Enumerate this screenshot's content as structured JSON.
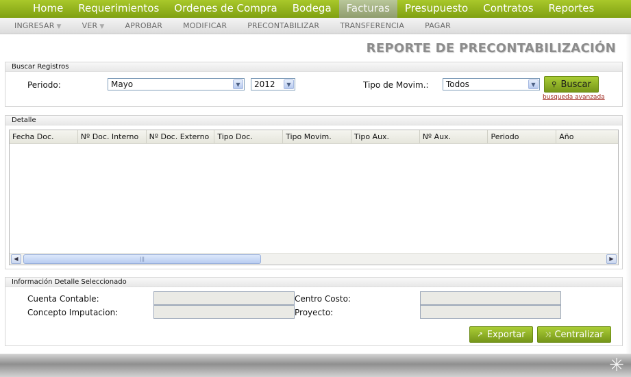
{
  "nav": {
    "items": [
      {
        "label": "Home",
        "active": false
      },
      {
        "label": "Requerimientos",
        "active": false
      },
      {
        "label": "Ordenes de Compra",
        "active": false
      },
      {
        "label": "Bodega",
        "active": false
      },
      {
        "label": "Facturas",
        "active": true
      },
      {
        "label": "Presupuesto",
        "active": false
      },
      {
        "label": "Contratos",
        "active": false
      },
      {
        "label": "Reportes",
        "active": false
      }
    ]
  },
  "subnav": {
    "items": [
      {
        "label": "INGRESAR",
        "caret": "▼"
      },
      {
        "label": "VER",
        "caret": "▼"
      },
      {
        "label": "APROBAR",
        "caret": ""
      },
      {
        "label": "MODIFICAR",
        "caret": ""
      },
      {
        "label": "PRECONTABILIZAR",
        "caret": ""
      },
      {
        "label": "TRANSFERENCIA",
        "caret": ""
      },
      {
        "label": "PAGAR",
        "caret": ""
      }
    ]
  },
  "page_title": "REPORTE DE PRECONTABILIZACIÓN",
  "buscar": {
    "header": "Buscar Registros",
    "periodo_label": "Periodo:",
    "mes_value": "Mayo",
    "anio_value": "2012",
    "tipo_mov_label": "Tipo de Movim.:",
    "tipo_mov_value": "Todos",
    "buscar_label": "Buscar",
    "avanzada_label": "busqueda avanzada"
  },
  "detalle": {
    "header": "Detalle",
    "columns": [
      "Fecha Doc.",
      "Nº Doc. Interno",
      "Nº Doc. Externo",
      "Tipo Doc.",
      "Tipo Movim.",
      "Tipo Aux.",
      "Nº Aux.",
      "Periodo",
      "Año"
    ],
    "scroll_grip": "|||",
    "scroll_left": "◀",
    "scroll_right": "▶"
  },
  "info": {
    "header": "Información Detalle Seleccionado",
    "cuenta_label": "Cuenta Contable:",
    "concepto_label": "Concepto Imputacion:",
    "centro_label": "Centro Costo:",
    "proyecto_label": "Proyecto:",
    "exportar_label": "Exportar",
    "centralizar_label": "Centralizar"
  },
  "icons": {
    "dropdown": "chevron-down-icon",
    "search": "search-icon",
    "export": "external-link-icon",
    "centralize": "shuffle-icon"
  },
  "colors": {
    "nav_green": "#8db21d",
    "button_green": "#8fb526",
    "link_red": "#a0281e"
  }
}
